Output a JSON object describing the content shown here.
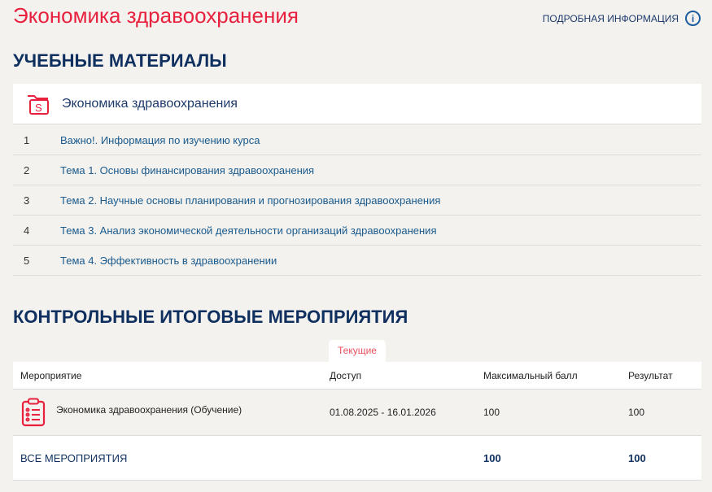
{
  "header": {
    "title": "Экономика здравоохранения",
    "info_label": "ПОДРОБНАЯ ИНФОРМАЦИЯ",
    "info_icon": "info-icon"
  },
  "materials": {
    "heading": "УЧЕБНЫЕ МАТЕРИАЛЫ",
    "course_title": "Экономика здравоохранения",
    "items": [
      {
        "num": "1",
        "label": "Важно!. Информация по изучению курса"
      },
      {
        "num": "2",
        "label": "Тема 1. Основы финансирования здравоохранения"
      },
      {
        "num": "3",
        "label": "Тема 2. Научные основы планирования и прогнозирования здравоохранения"
      },
      {
        "num": "4",
        "label": "Тема 3. Анализ экономической деятельности организаций здравоохранения"
      },
      {
        "num": "5",
        "label": "Тема 4. Эффективность в здравоохранении"
      }
    ]
  },
  "events": {
    "heading": "КОНТРОЛЬНЫЕ ИТОГОВЫЕ МЕРОПРИЯТИЯ",
    "tab": "Текущие",
    "columns": [
      "Мероприятие",
      "Доступ",
      "Максимальный балл",
      "Результат"
    ],
    "rows": [
      {
        "name": "Экономика здравоохранения (Обучение)",
        "access": "01.08.2025 - 16.01.2026",
        "max": "100",
        "result": "100"
      }
    ],
    "total": {
      "label": "ВСЕ МЕРОПРИЯТИЯ",
      "max": "100",
      "result": "100"
    }
  },
  "colors": {
    "accent": "#e8213f",
    "navy": "#0f2f5f"
  }
}
